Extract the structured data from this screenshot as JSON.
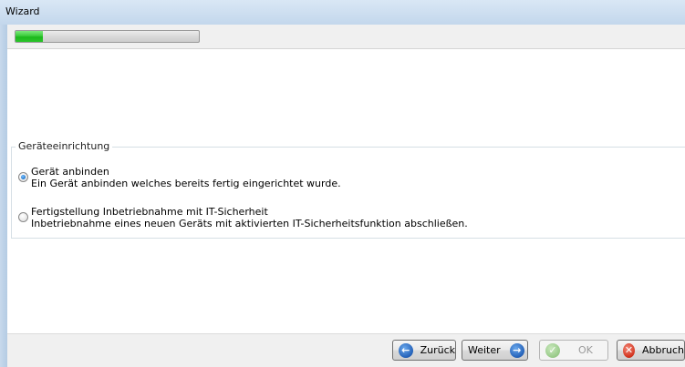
{
  "window": {
    "title": "Wizard"
  },
  "progress": {
    "value_fraction": 0.15,
    "fill_color": "#2bc42b"
  },
  "group": {
    "legend": "Geräteeinrichtung",
    "options": [
      {
        "title": "Gerät anbinden",
        "description": "Ein Gerät anbinden welches bereits fertig eingerichtet wurde.",
        "selected": true
      },
      {
        "title": "Fertigstellung Inbetriebnahme mit IT-Sicherheit",
        "description": "Inbetriebnahme eines neuen Geräts mit aktivierten IT-Sicherheitsfunktion abschließen.",
        "selected": false
      }
    ]
  },
  "footer": {
    "back_label": "Zurück",
    "back_icon": "arrow-left-circle-icon",
    "next_label": "Weiter",
    "next_icon": "arrow-right-circle-icon",
    "ok_label": "OK",
    "ok_icon": "check-circle-icon",
    "cancel_label": "Abbruch",
    "cancel_icon": "x-circle-icon"
  }
}
